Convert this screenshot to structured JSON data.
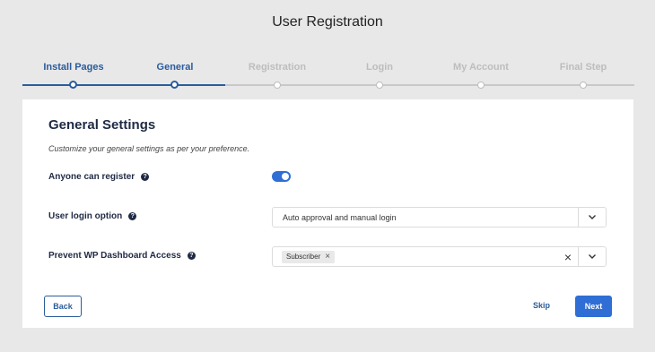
{
  "page": {
    "title": "User Registration"
  },
  "stepper": {
    "steps": [
      {
        "label": "Install Pages",
        "state": "done"
      },
      {
        "label": "General",
        "state": "current"
      },
      {
        "label": "Registration",
        "state": "upcoming"
      },
      {
        "label": "Login",
        "state": "upcoming"
      },
      {
        "label": "My Account",
        "state": "upcoming"
      },
      {
        "label": "Final Step",
        "state": "upcoming"
      }
    ]
  },
  "card": {
    "title": "General Settings",
    "subtitle": "Customize your general settings as per your preference.",
    "anyone_can_register": {
      "label": "Anyone can register",
      "enabled": true
    },
    "login_option": {
      "label": "User login option",
      "value": "Auto approval and manual login"
    },
    "prevent_dashboard": {
      "label": "Prevent WP Dashboard Access",
      "tag": "Subscriber"
    }
  },
  "actions": {
    "back": "Back",
    "skip": "Skip",
    "next": "Next"
  },
  "colors": {
    "accent": "#2f6ed4",
    "primary_text": "#2b5c9c",
    "inactive": "#bdbdbd"
  },
  "icons": {
    "help": "help-icon",
    "chevron": "chevron-down-icon",
    "clear": "clear-icon",
    "tag_remove": "close-icon"
  }
}
